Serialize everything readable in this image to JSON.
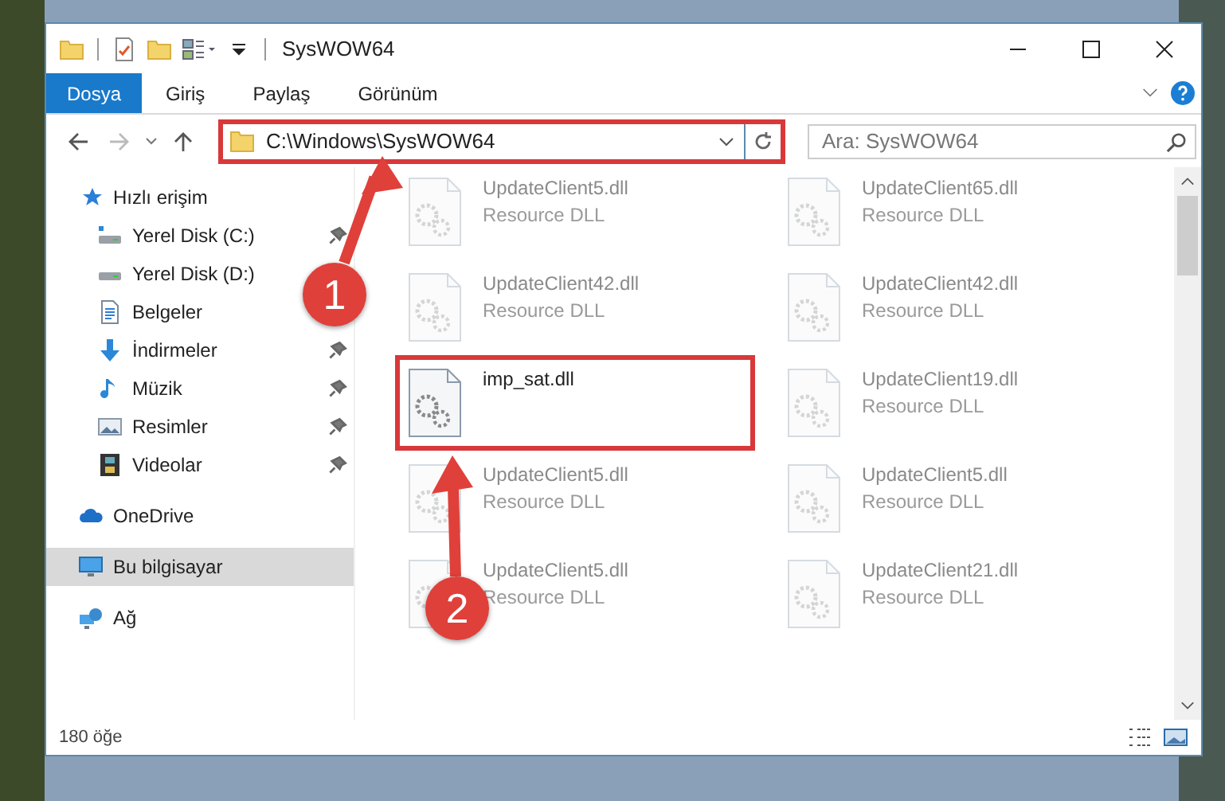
{
  "window": {
    "title": "SysWOW64"
  },
  "quick_toolbar": [
    {
      "kind": "folder"
    },
    {
      "kind": "properties"
    },
    {
      "kind": "new-folder"
    },
    {
      "kind": "view"
    },
    {
      "kind": "customize"
    }
  ],
  "ribbon_tabs": [
    {
      "label": "Dosya",
      "kind": "file"
    },
    {
      "label": "Giriş",
      "kind": "tab"
    },
    {
      "label": "Paylaş",
      "kind": "tab"
    },
    {
      "label": "Görünüm",
      "kind": "tab"
    }
  ],
  "address": {
    "path": "C:\\Windows\\SysWOW64",
    "highlighted": true
  },
  "search": {
    "placeholder": "Ara: SysWOW64"
  },
  "nav": [
    {
      "label": "Hızlı erişim",
      "kind": "star",
      "selected": false,
      "children": [
        {
          "label": "Yerel Disk (C:)",
          "kind": "drive-win",
          "pinned": true,
          "selected": false
        },
        {
          "label": "Yerel Disk (D:)",
          "kind": "drive",
          "pinned": false,
          "selected": false
        },
        {
          "label": "Belgeler",
          "kind": "document",
          "pinned": false,
          "selected": false
        },
        {
          "label": "İndirmeler",
          "kind": "download",
          "pinned": true,
          "selected": false
        },
        {
          "label": "Müzik",
          "kind": "music",
          "pinned": true,
          "selected": false
        },
        {
          "label": "Resimler",
          "kind": "picture",
          "pinned": true,
          "selected": false
        },
        {
          "label": "Videolar",
          "kind": "film",
          "pinned": true,
          "selected": false
        }
      ]
    },
    {
      "label": "OneDrive",
      "kind": "cloud",
      "selected": false
    },
    {
      "label": "Bu bilgisayar",
      "kind": "monitor",
      "selected": true
    },
    {
      "label": "Ağ",
      "kind": "network",
      "selected": false
    }
  ],
  "files": [
    {
      "name": "UpdateClient5.dll",
      "type": "Resource DLL",
      "faded": true,
      "highlighted": false
    },
    {
      "name": "UpdateClient65.dll",
      "type": "Resource DLL",
      "faded": true,
      "highlighted": false
    },
    {
      "name": "UpdateClient42.dll",
      "type": "Resource DLL",
      "faded": true,
      "highlighted": false
    },
    {
      "name": "UpdateClient42.dll",
      "type": "Resource DLL",
      "faded": true,
      "highlighted": false
    },
    {
      "name": "imp_sat.dll",
      "faded": false,
      "highlighted": true
    },
    {
      "name": "UpdateClient19.dll",
      "type": "Resource DLL",
      "faded": true,
      "highlighted": false
    },
    {
      "name": "UpdateClient5.dll",
      "type": "Resource DLL",
      "faded": true,
      "highlighted": false
    },
    {
      "name": "UpdateClient5.dll",
      "type": "Resource DLL",
      "faded": true,
      "highlighted": false
    },
    {
      "name": "UpdateClient5.dll",
      "type": "Resource DLL",
      "faded": true,
      "highlighted": false
    },
    {
      "name": "UpdateClient21.dll",
      "type": "Resource DLL",
      "faded": true,
      "highlighted": false
    }
  ],
  "status_bar": {
    "count": "180 öğe"
  },
  "annotations": [
    {
      "label": "1"
    },
    {
      "label": "2"
    }
  ]
}
